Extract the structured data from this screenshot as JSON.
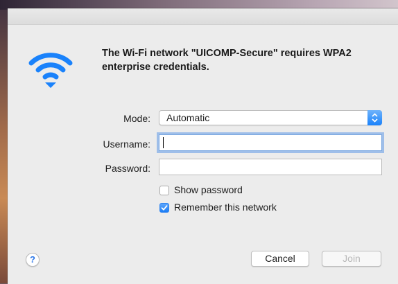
{
  "dialog": {
    "message": "The Wi-Fi network \"UICOMP-Secure\" requires WPA2 enterprise credentials.",
    "icon": "wifi-icon",
    "accent_color": "#1a82fb"
  },
  "form": {
    "mode_label": "Mode:",
    "mode_value": "Automatic",
    "username_label": "Username:",
    "username_value": "",
    "password_label": "Password:",
    "password_value": ""
  },
  "options": {
    "show_password_label": "Show password",
    "show_password_checked": false,
    "remember_label": "Remember this network",
    "remember_checked": true
  },
  "buttons": {
    "help_label": "?",
    "cancel_label": "Cancel",
    "join_label": "Join",
    "join_enabled": false
  }
}
